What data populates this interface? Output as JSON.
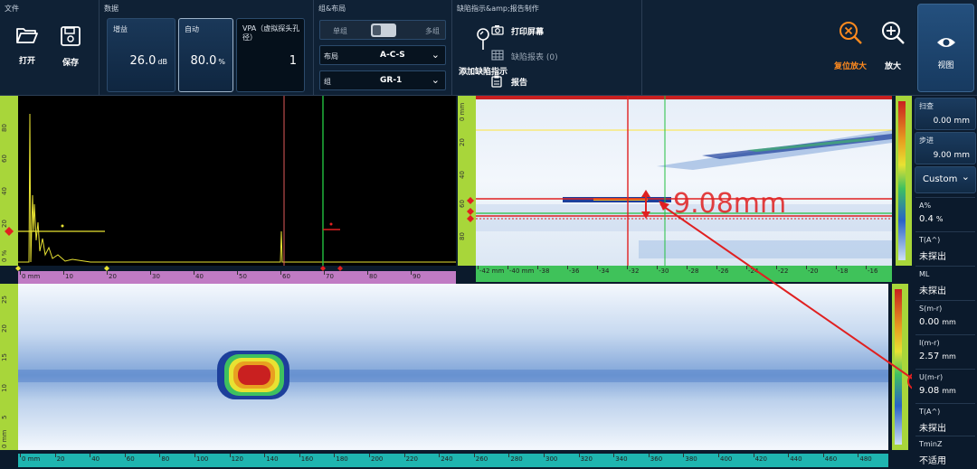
{
  "ribbon": {
    "file": {
      "title": "文件",
      "open": "打开",
      "save": "保存"
    },
    "data": {
      "title": "数据",
      "gain": {
        "label": "增益",
        "value": "26.0",
        "unit": "dB"
      },
      "auto": {
        "label": "自动",
        "value": "80.0",
        "unit": "%"
      },
      "vpa": {
        "label": "VPA（虚拟探头孔径）",
        "value": "1"
      }
    },
    "group_layout": {
      "title": "组&布局",
      "single": "单组",
      "multi": "多组",
      "layout_label": "布局",
      "layout_value": "A-C-S",
      "group_label": "组",
      "group_value": "GR-1"
    },
    "report": {
      "title": "缺陷指示&amp;报告制作",
      "add_indication": "添加缺陷指示",
      "print_screen": "打印屏幕",
      "defect_table": "缺陷报表 (0)",
      "report": "报告"
    },
    "zoom": {
      "reset": "复位放大",
      "zoom": "放大"
    },
    "view": "视图"
  },
  "ascan": {
    "x_unit": "0 mm",
    "x_ticks": [
      "10",
      "20",
      "30",
      "40",
      "50",
      "60",
      "70",
      "80",
      "90"
    ],
    "y_ticks": [
      "80",
      "60",
      "40",
      "20",
      "0 %"
    ]
  },
  "bscan": {
    "x_ticks": [
      "-42 mm",
      "-40 mm",
      "-38",
      "-36",
      "-34",
      "-32",
      "-30",
      "-28",
      "-26",
      "-24",
      "-22",
      "-20",
      "-18",
      "-16"
    ],
    "y_ticks": [
      "0 mm",
      "20",
      "40",
      "60",
      "80"
    ],
    "annotation": "9.08mm"
  },
  "cscan": {
    "x_ticks": [
      "0 mm",
      "20",
      "40",
      "60",
      "80",
      "100",
      "120",
      "140",
      "160",
      "180",
      "200",
      "220",
      "240",
      "260",
      "280",
      "300",
      "320",
      "340",
      "360",
      "380",
      "400",
      "420",
      "440",
      "460",
      "480"
    ],
    "y_ticks": [
      "0 mm",
      "5",
      "10",
      "15",
      "20",
      "25"
    ]
  },
  "sidebar": {
    "scan": {
      "label": "扫查",
      "value": "0.00 mm"
    },
    "index": {
      "label": "步进",
      "value": "9.00 mm"
    },
    "custom": "Custom",
    "readings": [
      {
        "label": "A%",
        "value": "0.4",
        "unit": "%"
      },
      {
        "label": "T(A^)",
        "value": "未探出",
        "unit": ""
      },
      {
        "label": "ML",
        "value": "未探出",
        "unit": ""
      },
      {
        "label": "S(m-r)",
        "value": "0.00",
        "unit": "mm"
      },
      {
        "label": "I(m-r)",
        "value": "2.57",
        "unit": "mm"
      },
      {
        "label": "U(m-r)",
        "value": "9.08",
        "unit": "mm"
      },
      {
        "label": "T(A^)",
        "value": "未探出",
        "unit": ""
      },
      {
        "label": "TminZ",
        "value": "不适用",
        "unit": ""
      }
    ]
  },
  "colors": {
    "ribbon": "#0f2135",
    "accent_orange": "#ff8a1e",
    "gate_red": "#e02020",
    "scale_green": "#a8d63a",
    "scale_purple": "#c07bc4",
    "scale_teal": "#1fb5b0"
  }
}
